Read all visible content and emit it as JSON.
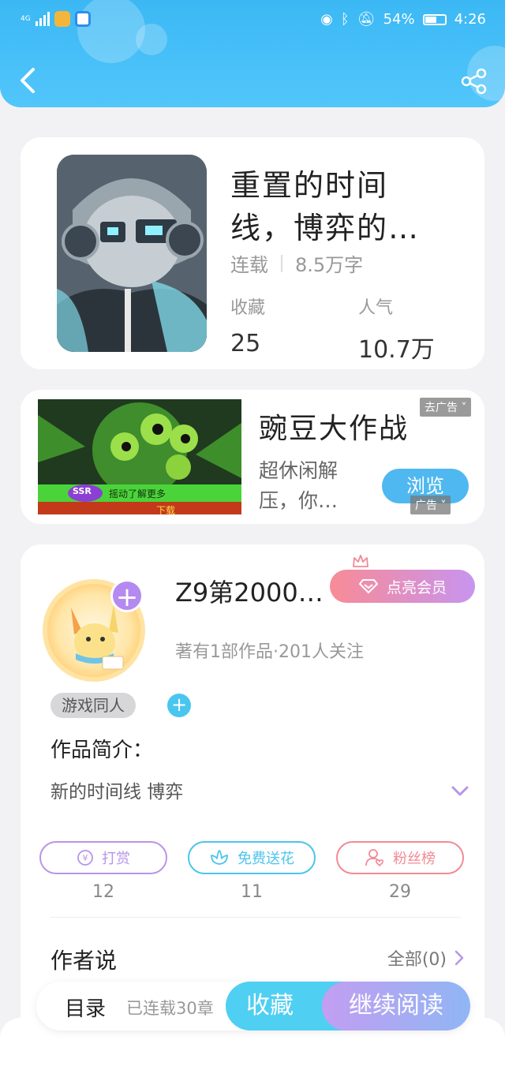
{
  "status_bar": {
    "network": "4G",
    "battery": "54%",
    "time": "4:26"
  },
  "book": {
    "title": "重置的时间线，博弈的…",
    "status": "连载",
    "word_count": "8.5万字",
    "collect_label": "收藏",
    "collect_value": "25",
    "popularity_label": "人气",
    "popularity_value": "10.7万"
  },
  "ad": {
    "title": "豌豆大作战",
    "description": "超休闲解压，你…",
    "button": "浏览",
    "remove_label": "去广告",
    "ad_label": "广告",
    "image_caption": "摇动了解更多",
    "badge": "SSR",
    "image_bottom": "下载"
  },
  "author": {
    "name": "Z9第2000…",
    "vip_button": "点亮会员",
    "sub": "著有1部作品·201人关注",
    "tag": "游戏同人",
    "intro_label": "作品简介：",
    "intro_text": "新的时间线 博弈",
    "actions": [
      {
        "label": "打赏",
        "count": "12",
        "icon": "yuan-icon",
        "color": "#b895e8"
      },
      {
        "label": "免费送花",
        "count": "11",
        "icon": "flower-icon",
        "color": "#4cc4ec"
      },
      {
        "label": "粉丝榜",
        "count": "29",
        "icon": "fans-icon",
        "color": "#f28a95"
      }
    ],
    "says_label": "作者说",
    "says_all": "全部(0)"
  },
  "bottom_bar": {
    "toc": "目录",
    "toc_sub": "已连载30章",
    "favorite": "收藏",
    "continue": "继续阅读"
  },
  "colors": {
    "header": "#3bb8f4",
    "accent_purple": "#b58af0",
    "accent_blue": "#4fcff2"
  }
}
